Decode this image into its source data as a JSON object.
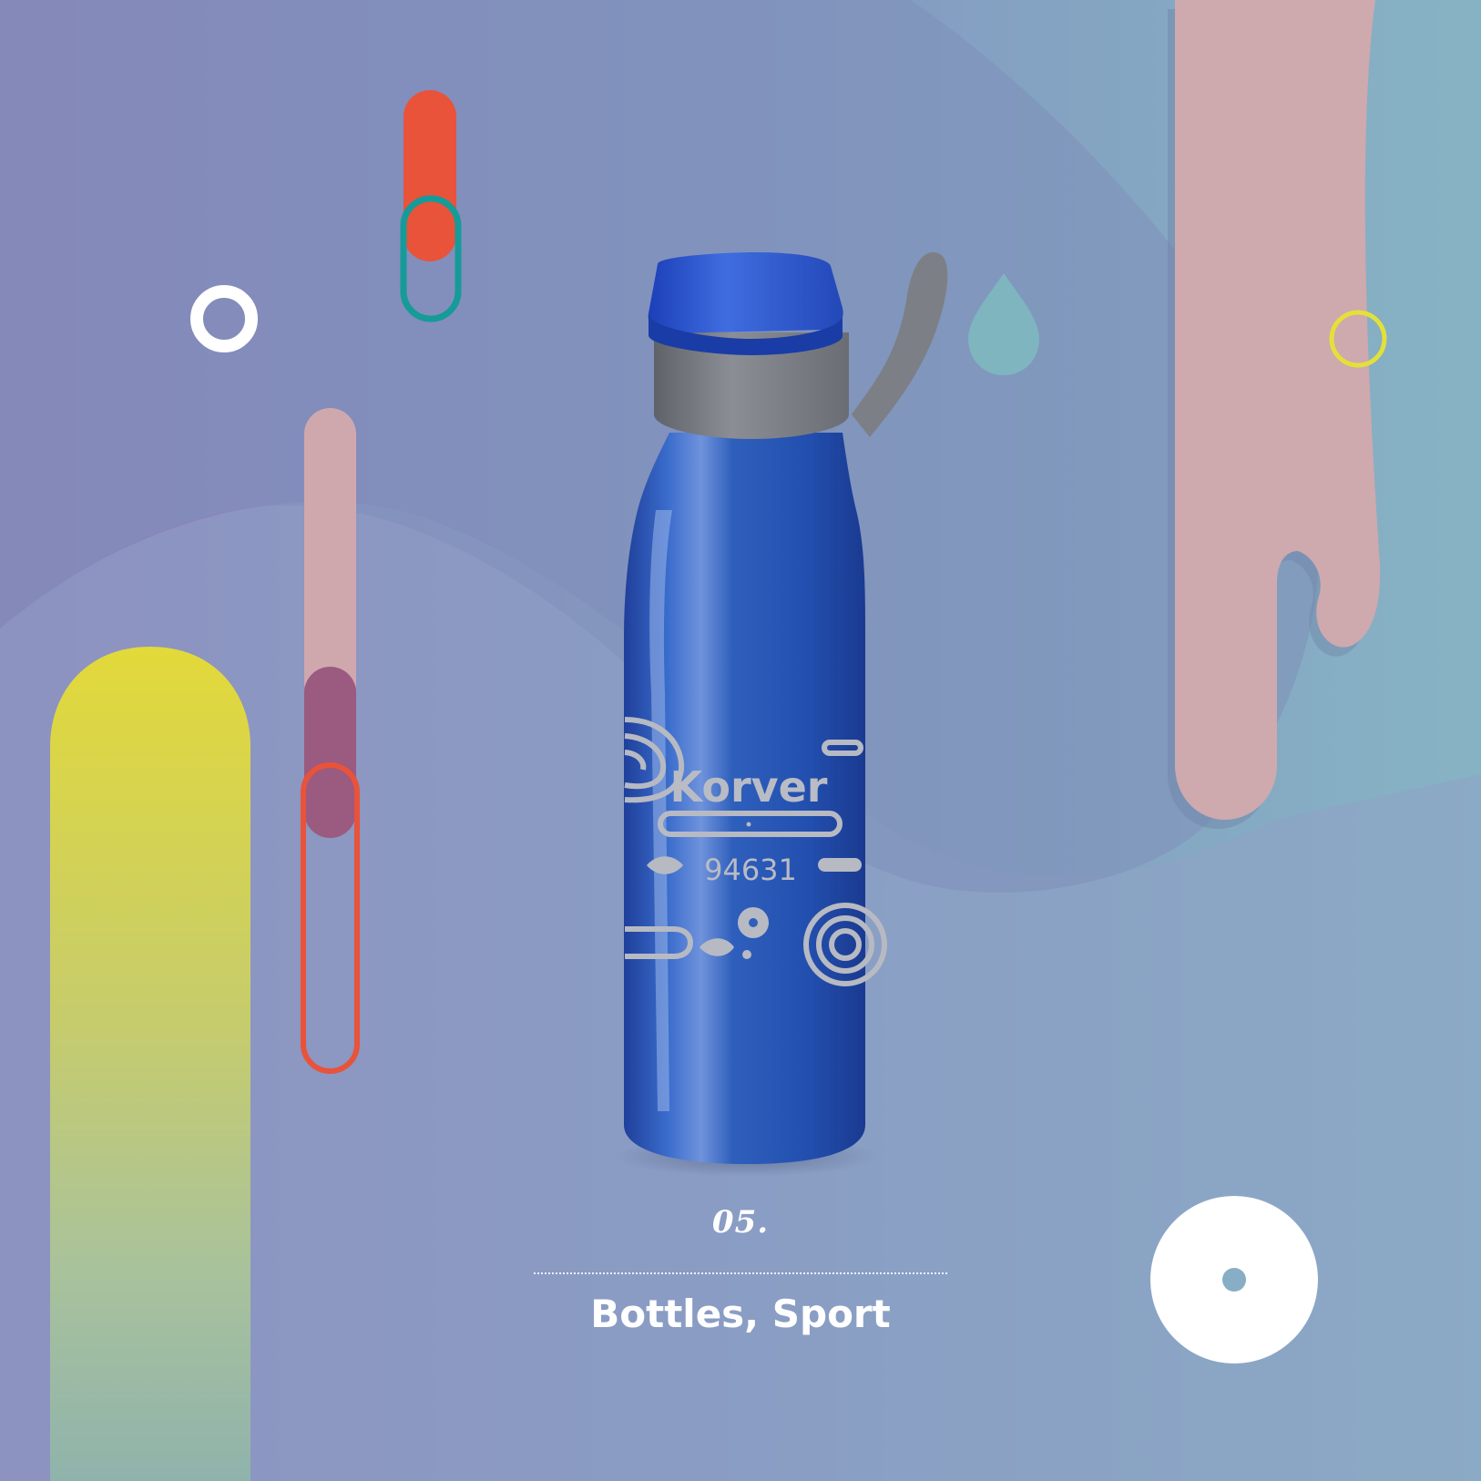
{
  "catalog": {
    "number": "05.",
    "title": "Bottles, Sport"
  },
  "product": {
    "brand_text": "Korver",
    "code_text": "94631",
    "bottle_color": "#2f5fb8",
    "cap_color": "#2a55c8",
    "band_color": "#7c7f87",
    "engraving_color": "#b9bcc4"
  },
  "palette": {
    "bg_left": "#8a82b8",
    "bg_right": "#88b2c6",
    "accent_orange": "#e85535",
    "accent_teal": "#1a9a98",
    "accent_pink": "#cfa8ae",
    "accent_plum": "#9b5a7e",
    "accent_yellow": "#e2dc3c",
    "white": "#ffffff"
  }
}
